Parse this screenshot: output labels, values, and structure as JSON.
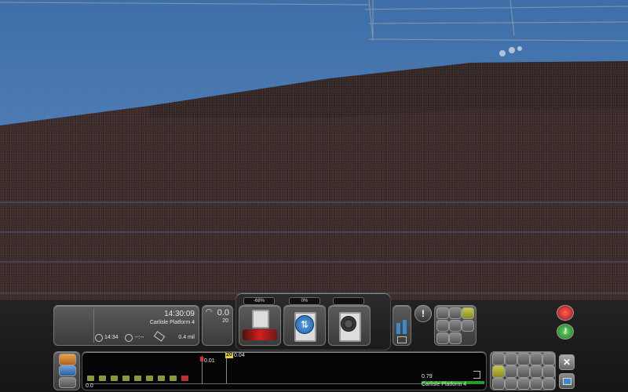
{
  "hud": {
    "clock": "14:30:09",
    "location": "Carlisle Platform 4",
    "eta": "14:34",
    "eta_extra": "--:--",
    "distance": "0.4 mil",
    "speed": "0.0",
    "speed_limit": "20"
  },
  "controls": {
    "reverser_pct": "-68%",
    "throttle_pct": "0%",
    "brake_pct": ""
  },
  "track_monitor": {
    "marker_speed": "20",
    "marker_label_1": "0.01",
    "marker_label_2": "0.04",
    "zero_label": "0.0",
    "end_distance": "0.79",
    "end_label": "Carlisle Platform 4",
    "segments": [
      "#8a9a3a",
      "#8a9a3a",
      "#8a9a3a",
      "#8a9a3a",
      "#8a9a3a",
      "#8a9a3a",
      "#8a9a3a",
      "#8a9a3a",
      "#c03030"
    ]
  },
  "icons": {
    "left_column": [
      "map-icon",
      "camera-switch-icon"
    ],
    "right_grid": [
      "wagon-icon",
      "lamp-icon",
      "coupler-icon",
      "horn-icon",
      "pantograph-icon",
      "brake-icon",
      "sand-icon",
      "bell-icon"
    ],
    "bottom_grid": [
      "wrench-icon",
      "signal-icon",
      "door-icon",
      "loco-icon",
      "pause-icon",
      "look-icon",
      "move-icon",
      "clock-icon",
      "camera-icon",
      "save-icon"
    ],
    "exit_icon": "close-icon",
    "alert_icon": "alarm-icon",
    "key_icon": "key-icon"
  }
}
